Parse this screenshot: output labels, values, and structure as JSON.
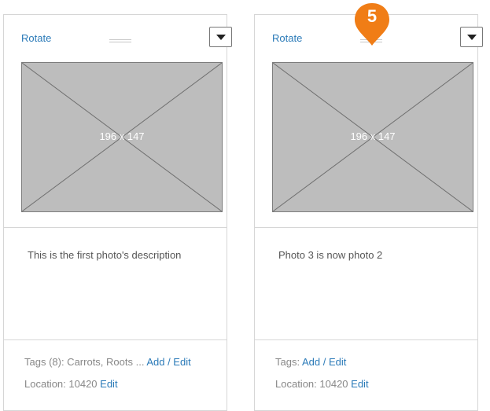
{
  "cards": [
    {
      "rotate_label": "Rotate",
      "placeholder_label": "196 x 147",
      "description": "This is the first photo's description",
      "tags_label": "Tags (8): Carrots, Roots ...",
      "tags_action": "Add / Edit",
      "location_label": "Location: 10420",
      "location_action": "Edit"
    },
    {
      "rotate_label": "Rotate",
      "placeholder_label": "196 x 147",
      "description": "Photo 3 is now photo 2",
      "tags_label": "Tags:",
      "tags_action": "Add / Edit",
      "location_label": "Location: 10420",
      "location_action": "Edit"
    }
  ],
  "annotation": {
    "step_number": "5",
    "color": "#f07d16"
  },
  "colors": {
    "link": "#2a7ab8",
    "placeholder_fill": "#bdbdbd",
    "border": "#d6d6d6"
  }
}
